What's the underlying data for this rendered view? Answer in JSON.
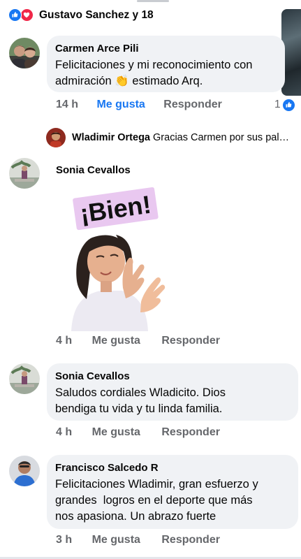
{
  "header": {
    "reactors": "Gustavo Sanchez y 18"
  },
  "comments": [
    {
      "author": "Carmen Arce Pili",
      "lines": [
        "Felicitaciones y mi reconocimiento con",
        "admiración 👏 estimado Arq."
      ],
      "time": "14 h",
      "like_label": "Me gusta",
      "reply_label": "Responder",
      "liked": true,
      "reaction_count": "1",
      "reply_preview": {
        "author": "Wladimir Ortega",
        "text": "Gracias Carmen por sus pal…"
      }
    },
    {
      "author": "Sonia Cevallos",
      "sticker": {
        "caption": "¡Bien!"
      },
      "time": "4 h",
      "like_label": "Me gusta",
      "reply_label": "Responder"
    },
    {
      "author": "Sonia Cevallos",
      "lines": [
        "Saludos cordiales Wladicito. Dios",
        "bendiga tu vida y tu linda familia."
      ],
      "time": "4 h",
      "like_label": "Me gusta",
      "reply_label": "Responder"
    },
    {
      "author": "Francisco Salcedo R",
      "lines": [
        "Felicitaciones Wladimir, gran esfuerzo y",
        "grandes  logros en el deporte que más",
        "nos apasiona. Un abrazo fuerte"
      ],
      "time": "3 h",
      "like_label": "Me gusta",
      "reply_label": "Responder"
    }
  ],
  "colors": {
    "accent": "#1877f2",
    "love": "#f02849",
    "bubble": "#f0f2f5",
    "meta_text": "#65676b",
    "sticker_banner": "#e9c8f0"
  },
  "icons": [
    "like-reaction-icon",
    "love-reaction-icon",
    "like-count-icon"
  ]
}
